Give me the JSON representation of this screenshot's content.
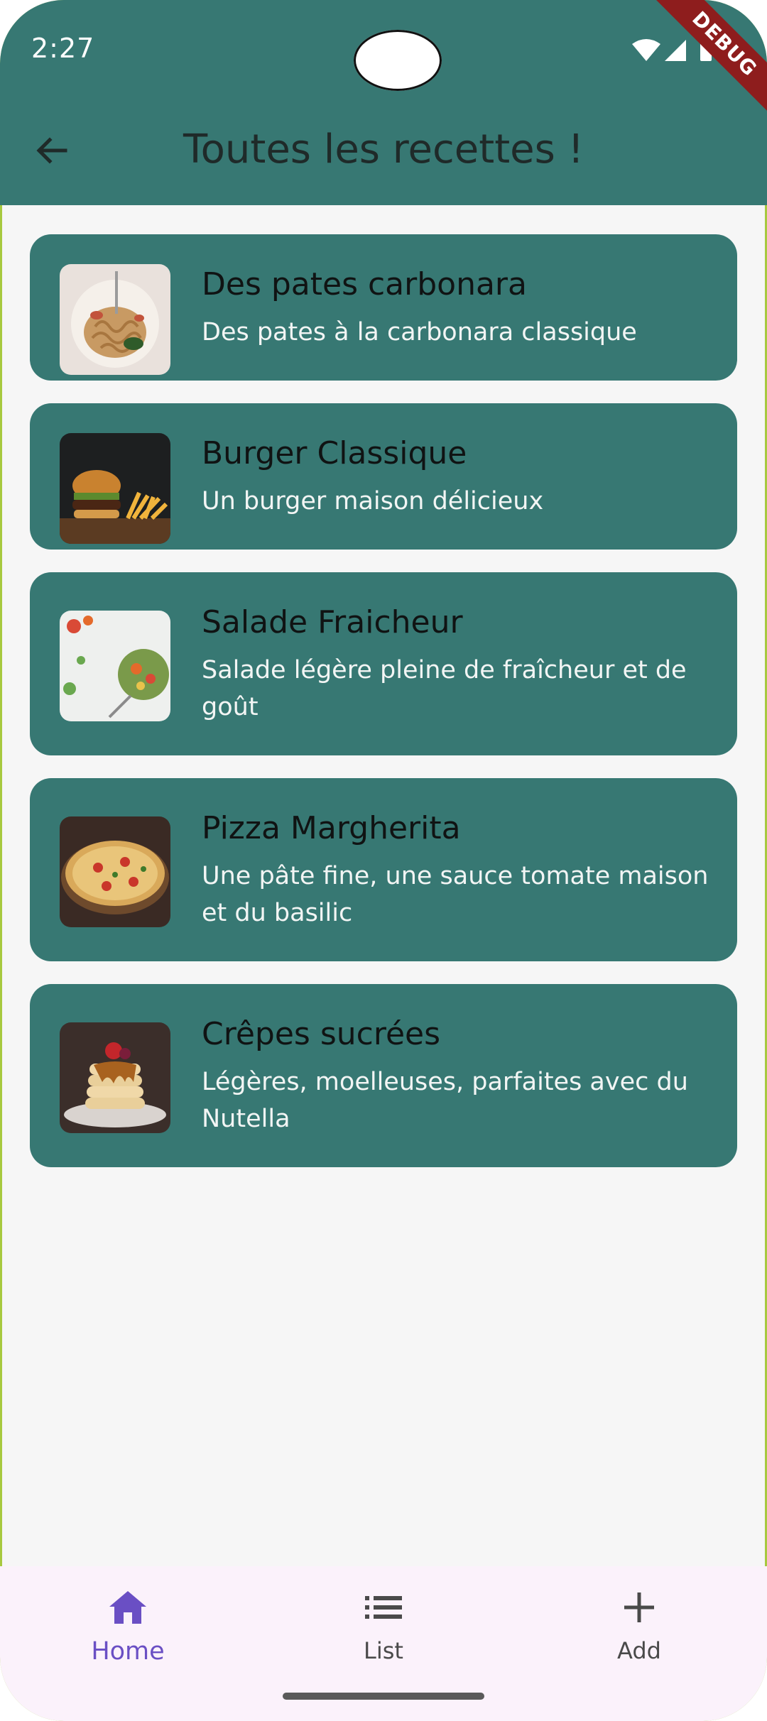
{
  "status_bar": {
    "time": "2:27",
    "icons": [
      "wifi-icon",
      "cell-signal-icon",
      "battery-icon"
    ],
    "debug_label": "DEBUG"
  },
  "app_bar": {
    "back_icon": "arrow-left-icon",
    "title": "Toutes les recettes !",
    "background": "#377873"
  },
  "recipes": [
    {
      "title": "Des pates carbonara",
      "description": "Des pates à la carbonara classique",
      "image": "pasta-photo"
    },
    {
      "title": "Burger Classique",
      "description": "Un burger maison délicieux",
      "image": "burger-photo"
    },
    {
      "title": "Salade Fraicheur",
      "description": "Salade légère pleine de fraîcheur et de goût",
      "image": "salad-photo"
    },
    {
      "title": "Pizza Margherita",
      "description": "Une pâte fine, une sauce tomate maison et du basilic",
      "image": "pizza-photo"
    },
    {
      "title": "Crêpes sucrées",
      "description": "Légères, moelleuses, parfaites avec du Nutella",
      "image": "crepes-photo"
    }
  ],
  "bottom_nav": {
    "items": [
      {
        "label": "Home",
        "icon": "home-icon",
        "active": true
      },
      {
        "label": "List",
        "icon": "list-icon",
        "active": false
      },
      {
        "label": "Add",
        "icon": "plus-icon",
        "active": false
      }
    ],
    "active_color": "#6a4fc4"
  }
}
